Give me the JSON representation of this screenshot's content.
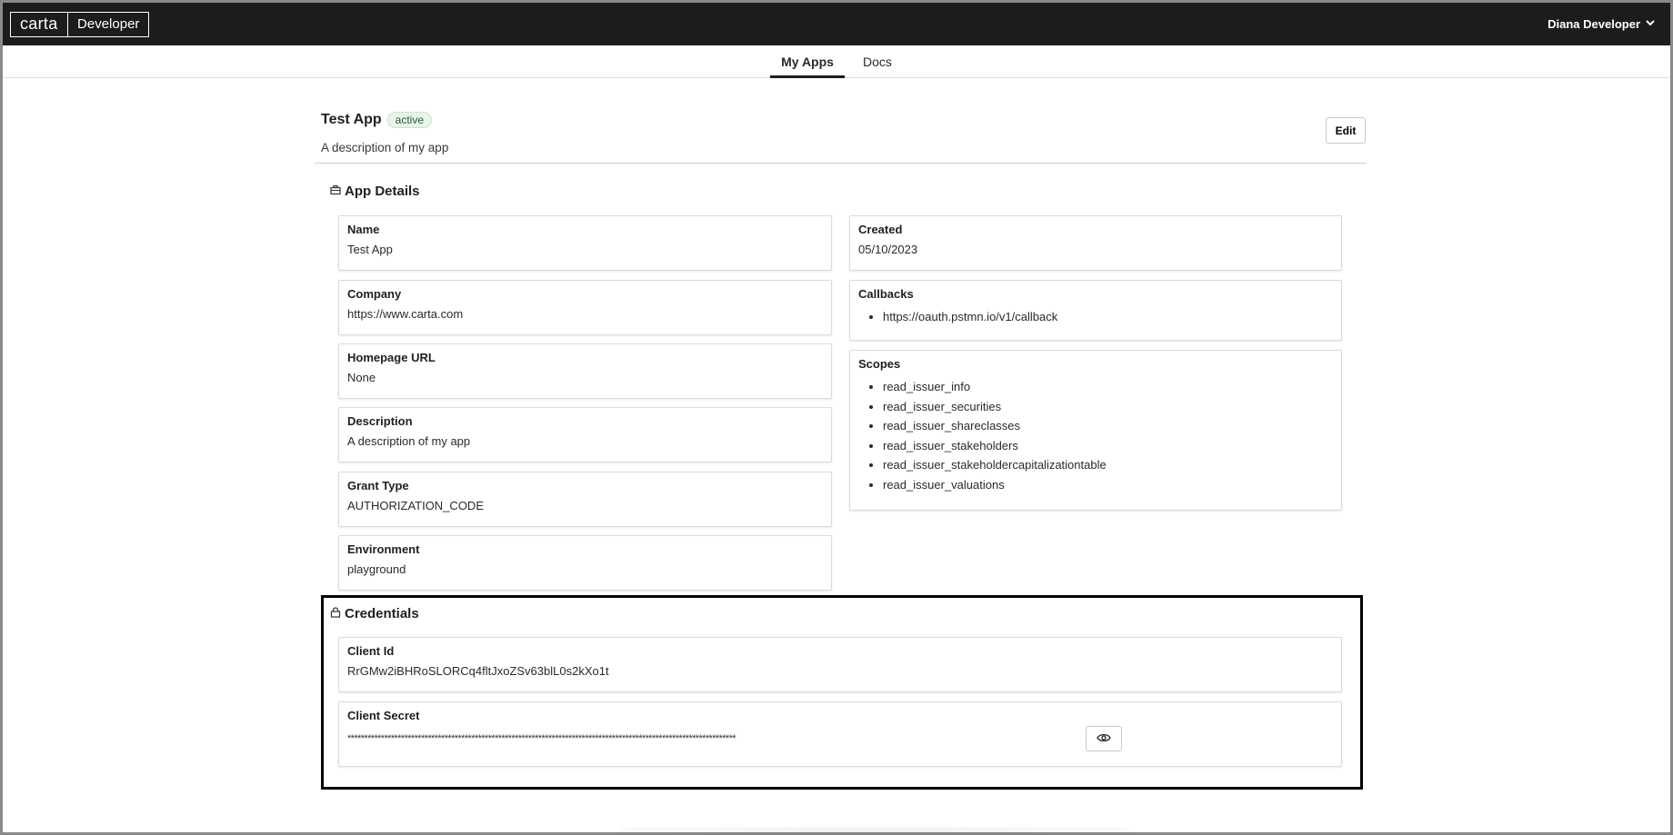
{
  "header": {
    "logo_brand": "carta",
    "logo_product": "Developer",
    "user_name": "Diana Developer"
  },
  "nav": {
    "tabs": [
      {
        "label": "My Apps",
        "active": true
      },
      {
        "label": "Docs",
        "active": false
      }
    ]
  },
  "app": {
    "title": "Test App",
    "status": "active",
    "description": "A description of my app",
    "edit_label": "Edit"
  },
  "details": {
    "section_title": "App Details",
    "name": {
      "label": "Name",
      "value": "Test App"
    },
    "company": {
      "label": "Company",
      "value": "https://www.carta.com"
    },
    "homepage": {
      "label": "Homepage URL",
      "value": "None"
    },
    "description": {
      "label": "Description",
      "value": "A description of my app"
    },
    "grant_type": {
      "label": "Grant Type",
      "value": "AUTHORIZATION_CODE"
    },
    "environment": {
      "label": "Environment",
      "value": "playground"
    },
    "created": {
      "label": "Created",
      "value": "05/10/2023"
    },
    "callbacks": {
      "label": "Callbacks",
      "items": [
        "https://oauth.pstmn.io/v1/callback"
      ]
    },
    "scopes": {
      "label": "Scopes",
      "items": [
        "read_issuer_info",
        "read_issuer_securities",
        "read_issuer_shareclasses",
        "read_issuer_stakeholders",
        "read_issuer_stakeholdercapitalizationtable",
        "read_issuer_valuations"
      ]
    }
  },
  "credentials": {
    "section_title": "Credentials",
    "client_id": {
      "label": "Client Id",
      "value": "RrGMw2iBHRoSLORCq4fltJxoZSv63blL0s2kXo1t"
    },
    "client_secret": {
      "label": "Client Secret",
      "value": "********************************************************************************************************************"
    }
  },
  "icons": {
    "details_icon": "briefcase-icon",
    "credentials_icon": "lock-icon",
    "user_menu_icon": "chevron-down-icon",
    "reveal_icon": "eye-icon"
  },
  "colors": {
    "topbar": "#1c1c1c",
    "badge_bg": "#e7f4ea",
    "badge_text": "#2a5a36"
  }
}
